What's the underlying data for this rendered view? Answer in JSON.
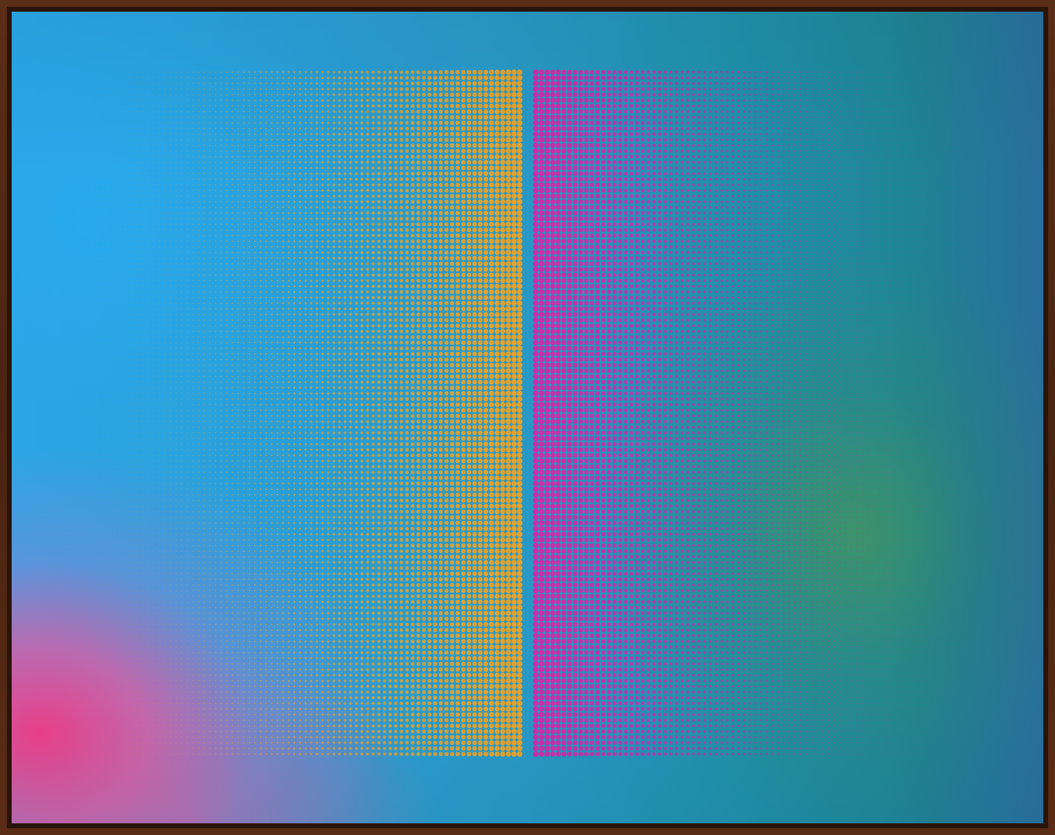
{
  "artwork": {
    "frame_color": "#4e2614",
    "background_colors": [
      "#2aa6e6",
      "#1f8596",
      "#f43a84",
      "#46965a"
    ],
    "left_dot_panel": {
      "dot_color": "#e8a22a",
      "grows_toward": "right"
    },
    "right_dot_panel": {
      "dot_color": "#d02aa8",
      "grows_toward": "left"
    }
  }
}
